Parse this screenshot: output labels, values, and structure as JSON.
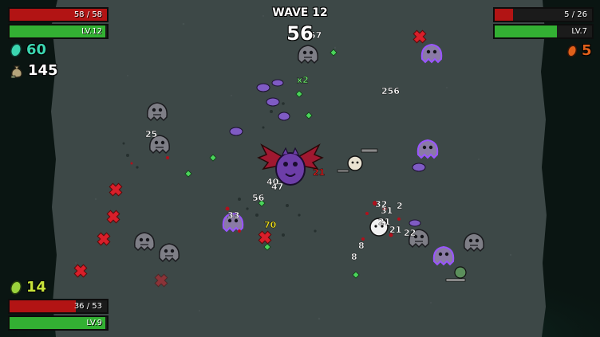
{
  "wave": {
    "label": "WAVE 12",
    "timer": "56"
  },
  "player1": {
    "hp": {
      "text": "58 / 58",
      "fraction": 1.0
    },
    "xp": {
      "text": "LV.12",
      "fraction": 0.98
    },
    "materials": "60",
    "bag": "145"
  },
  "player2": {
    "hp": {
      "text": "5 / 26",
      "fraction": 0.19
    },
    "xp": {
      "text": "LV.7",
      "fraction": 0.64
    },
    "materials": "5"
  },
  "player3": {
    "materials": "14",
    "hp": {
      "text": "36 / 53",
      "fraction": 0.68
    },
    "xp": {
      "text": "LV.9",
      "fraction": 0.98
    }
  },
  "floating_numbers": [
    "57",
    "x2",
    "256",
    "25",
    "56",
    "40",
    "47",
    "33",
    "70",
    "21",
    "31",
    "32",
    "21",
    "2",
    "22",
    "8",
    "8",
    "21"
  ],
  "colors": {
    "arena": "#3d4847",
    "hp": "#b21414",
    "xp": "#33b033",
    "material_teal": "#3bd6b0",
    "material_orange": "#e0601a",
    "material_green": "#9bd33c",
    "enemy_purple": "#7a4bc8",
    "damage_red": "#e02020"
  },
  "icons": [
    "material-teal-icon",
    "money-bag-icon",
    "material-orange-icon",
    "material-green-icon"
  ]
}
